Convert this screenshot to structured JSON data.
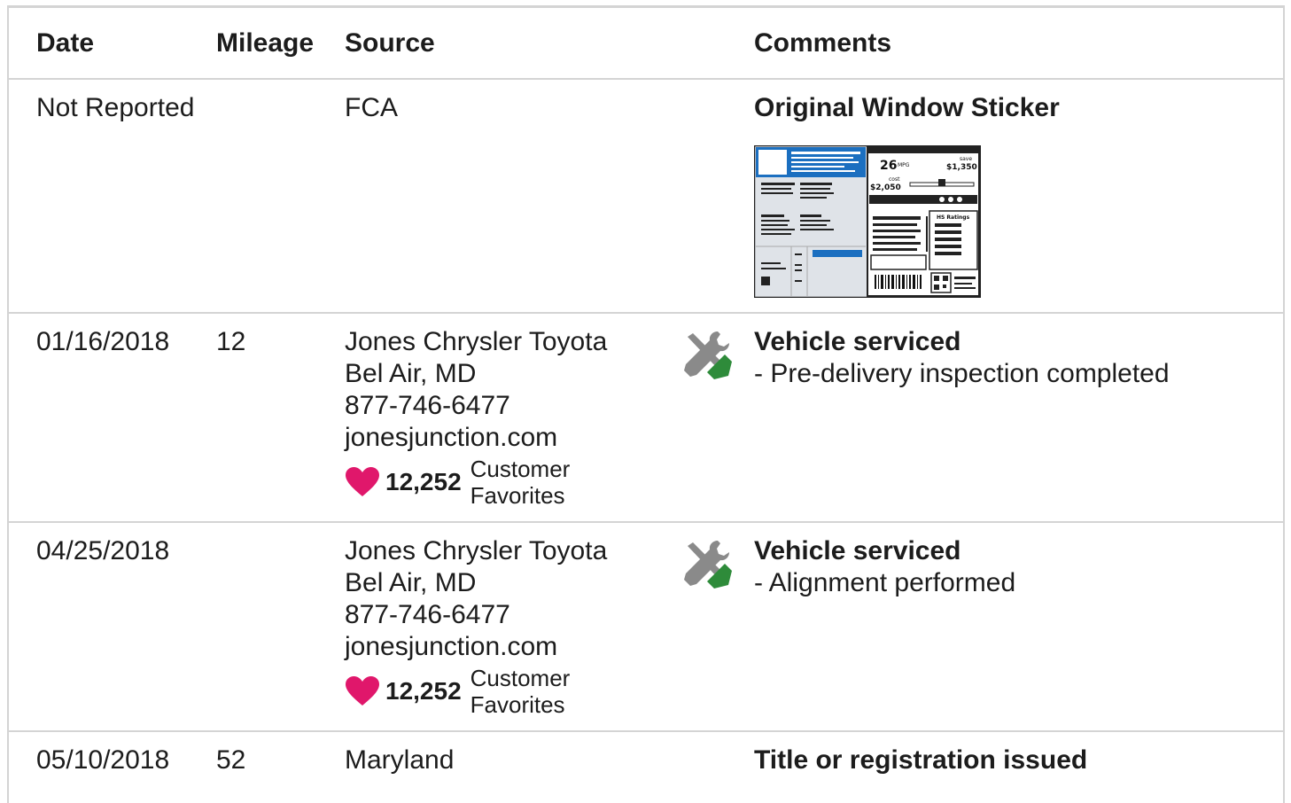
{
  "headers": {
    "date": "Date",
    "mileage": "Mileage",
    "source": "Source",
    "comments": "Comments"
  },
  "sticker": {
    "mpg": "26",
    "mpg_unit": "MPG",
    "save_label": "save",
    "save_amount": "$1,350",
    "cost_label": "cost",
    "cost_amount": "$2,050",
    "ratings_label": "HS Ratings"
  },
  "rows": [
    {
      "date": "Not Reported",
      "mileage": "",
      "source": [
        "FCA"
      ],
      "comment_title": "Original Window Sticker",
      "comment_detail": ""
    },
    {
      "date": "01/16/2018",
      "mileage": "12",
      "source": [
        "Jones Chrysler Toyota",
        "Bel Air, MD",
        "877-746-6477",
        "jonesjunction.com"
      ],
      "favorites": {
        "count": "12,252",
        "label_line1": "Customer",
        "label_line2": "Favorites"
      },
      "icon": "service-tools-icon",
      "comment_title": "Vehicle serviced",
      "comment_detail": "- Pre-delivery inspection completed"
    },
    {
      "date": "04/25/2018",
      "mileage": "",
      "source": [
        "Jones Chrysler Toyota",
        "Bel Air, MD",
        "877-746-6477",
        "jonesjunction.com"
      ],
      "favorites": {
        "count": "12,252",
        "label_line1": "Customer",
        "label_line2": "Favorites"
      },
      "icon": "service-tools-icon",
      "comment_title": "Vehicle serviced",
      "comment_detail": "- Alignment performed"
    },
    {
      "date": "05/10/2018",
      "mileage": "52",
      "source": [
        "Maryland"
      ],
      "comment_title": "Title or registration issued",
      "comment_detail": ""
    }
  ],
  "colors": {
    "heart": "#e0176b",
    "tool_grey": "#8a8a8a",
    "tool_green": "#2e8b3a",
    "border": "#d4d4d4",
    "sticker_blue": "#1b6fc0"
  }
}
